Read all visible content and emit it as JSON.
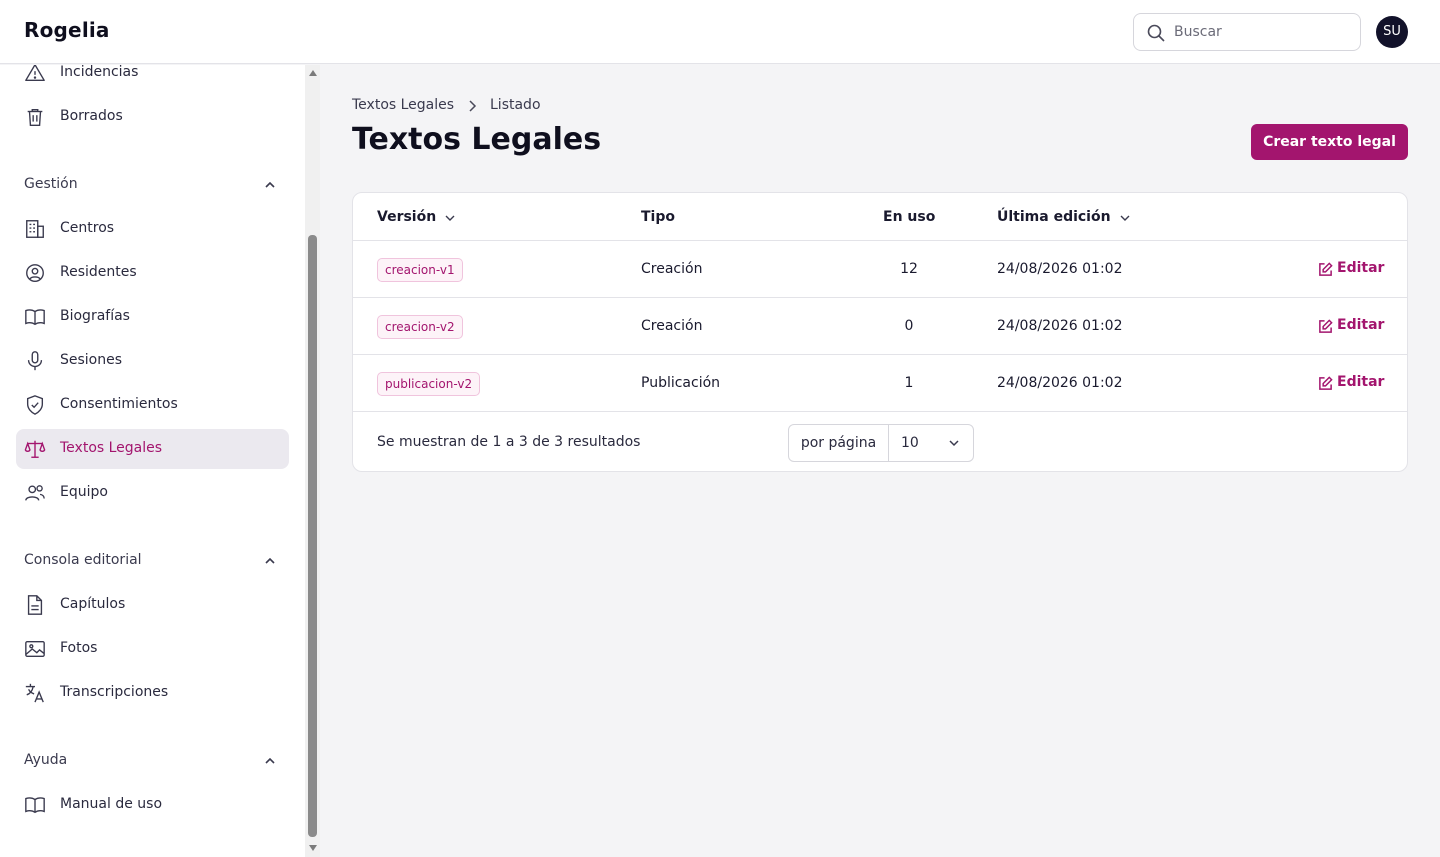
{
  "app": {
    "brand": "Rogelia",
    "user_initials": "SU"
  },
  "search": {
    "placeholder": "Buscar"
  },
  "sidebar": {
    "top_items": [
      {
        "label": "Incidencias",
        "icon": "warning-icon"
      },
      {
        "label": "Borrados",
        "icon": "trash-icon"
      }
    ],
    "groups": [
      {
        "title": "Gestión",
        "items": [
          {
            "label": "Centros",
            "icon": "building-icon"
          },
          {
            "label": "Residentes",
            "icon": "user-circle-icon"
          },
          {
            "label": "Biografías",
            "icon": "book-icon"
          },
          {
            "label": "Sesiones",
            "icon": "microphone-icon"
          },
          {
            "label": "Consentimientos",
            "icon": "shield-check-icon"
          },
          {
            "label": "Textos Legales",
            "icon": "scale-icon",
            "active": true
          },
          {
            "label": "Equipo",
            "icon": "users-icon"
          }
        ]
      },
      {
        "title": "Consola editorial",
        "items": [
          {
            "label": "Capítulos",
            "icon": "document-icon"
          },
          {
            "label": "Fotos",
            "icon": "photo-icon"
          },
          {
            "label": "Transcripciones",
            "icon": "language-icon"
          }
        ]
      },
      {
        "title": "Ayuda",
        "items": [
          {
            "label": "Manual de uso",
            "icon": "book-icon"
          }
        ]
      }
    ]
  },
  "breadcrumb": {
    "first": "Textos Legales",
    "second": "Listado"
  },
  "page": {
    "title": "Textos Legales",
    "create_label": "Crear texto legal"
  },
  "table": {
    "headers": {
      "version": "Versión",
      "type": "Tipo",
      "in_use": "En uso",
      "last_edit": "Última edición"
    },
    "rows": [
      {
        "version": "creacion-v1",
        "type": "Creación",
        "in_use": "12",
        "last_edit": "24/08/2026 01:02",
        "action": "Editar"
      },
      {
        "version": "creacion-v2",
        "type": "Creación",
        "in_use": "0",
        "last_edit": "24/08/2026 01:02",
        "action": "Editar"
      },
      {
        "version": "publicacion-v2",
        "type": "Publicación",
        "in_use": "1",
        "last_edit": "24/08/2026 01:02",
        "action": "Editar"
      }
    ],
    "summary": "Se muestran de 1 a 3 de 3 resultados",
    "per_page_label": "por página",
    "per_page_value": "10"
  },
  "colors": {
    "accent": "#a3156e",
    "active_bg": "#ebe9ef",
    "avatar_bg": "#12122a"
  }
}
